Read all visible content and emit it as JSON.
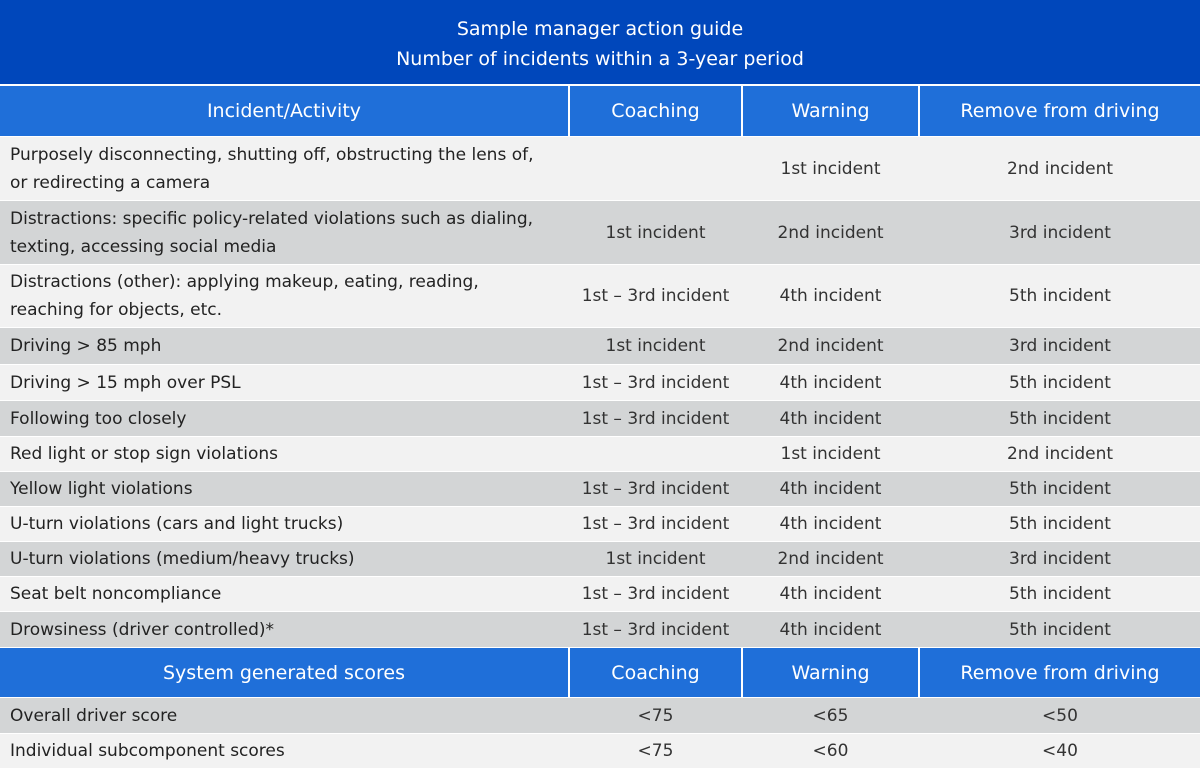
{
  "title": {
    "line1": "Sample manager action guide",
    "line2": "Number of incidents within a 3-year period"
  },
  "colors": {
    "title_band": "#0047BB",
    "header": "#1F6FD9",
    "row_light": "#F2F2F2",
    "row_dark": "#D3D5D6"
  },
  "incident_table": {
    "headers": [
      "Incident/Activity",
      "Coaching",
      "Warning",
      "Remove from driving"
    ],
    "rows": [
      {
        "activity": "Purposely disconnecting, shutting off, obstructing the lens of, or redirecting a camera",
        "coaching": "",
        "warning": "1st incident",
        "remove": "2nd incident"
      },
      {
        "activity": "Distractions: specific policy-related violations such as dialing, texting, accessing social media",
        "coaching": "1st incident",
        "warning": "2nd incident",
        "remove": "3rd incident"
      },
      {
        "activity": "Distractions (other): applying makeup, eating, reading, reaching for objects, etc.",
        "coaching": "1st – 3rd incident",
        "warning": "4th incident",
        "remove": "5th incident"
      },
      {
        "activity": "Driving > 85 mph",
        "coaching": "1st incident",
        "warning": "2nd incident",
        "remove": "3rd incident"
      },
      {
        "activity": "Driving > 15 mph over PSL",
        "coaching": "1st – 3rd incident",
        "warning": "4th incident",
        "remove": "5th incident"
      },
      {
        "activity": "Following too closely",
        "coaching": "1st – 3rd incident",
        "warning": "4th incident",
        "remove": "5th incident"
      },
      {
        "activity": "Red light or stop sign violations",
        "coaching": "",
        "warning": "1st incident",
        "remove": "2nd incident"
      },
      {
        "activity": "Yellow light violations",
        "coaching": "1st – 3rd incident",
        "warning": "4th incident",
        "remove": "5th incident"
      },
      {
        "activity": "U-turn violations (cars and light trucks)",
        "coaching": "1st – 3rd incident",
        "warning": "4th incident",
        "remove": "5th incident"
      },
      {
        "activity": "U-turn violations (medium/heavy trucks)",
        "coaching": "1st incident",
        "warning": "2nd incident",
        "remove": "3rd incident"
      },
      {
        "activity": "Seat belt noncompliance",
        "coaching": "1st – 3rd incident",
        "warning": "4th incident",
        "remove": "5th incident"
      },
      {
        "activity": "Drowsiness (driver controlled)*",
        "coaching": "1st – 3rd incident",
        "warning": "4th incident",
        "remove": "5th incident"
      }
    ]
  },
  "score_table": {
    "headers": [
      "System generated scores",
      "Coaching",
      "Warning",
      "Remove from driving"
    ],
    "rows": [
      {
        "activity": "Overall driver score",
        "coaching": "<75",
        "warning": "<65",
        "remove": "<50"
      },
      {
        "activity": "Individual subcomponent scores",
        "coaching": "<75",
        "warning": "<60",
        "remove": "<40"
      }
    ]
  }
}
